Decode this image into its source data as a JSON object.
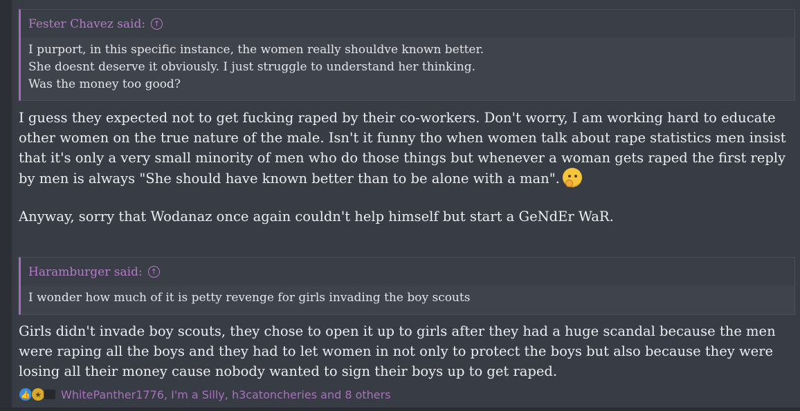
{
  "quote1": {
    "author": "Fester Chavez said:",
    "lines": [
      "I purport, in this specific instance, the women really shouldve known better.",
      "She doesnt deserve it obviously. I just struggle to understand her thinking.",
      "Was the money too good?"
    ]
  },
  "message1": {
    "paragraph1": "I guess they expected not to get fucking raped by their co-workers. Don't worry, I am working hard to educate other women on the true nature of the male. Isn't it funny tho when women talk about rape statistics men insist that it's only a very small minority of men who do those things but whenever a woman gets raped the first reply by men is always \"She should have known better than to be alone with a man\".",
    "emoji": "thinking-face-icon",
    "paragraph2": "Anyway, sorry that Wodanaz once again couldn't help himself but start a GeNdEr WaR."
  },
  "quote2": {
    "author": "Haramburger said:",
    "lines": [
      "I wonder how much of it is petty revenge for girls invading the boy scouts"
    ]
  },
  "message2": {
    "paragraph1": "Girls didn't invade boy scouts, they chose to open it up to girls after they had a huge scandal because the men were raping all the boys and they had to let women in not only to protect the boys but also because they were losing all their money cause nobody wanted to sign their boys up to get raped."
  },
  "reactions": {
    "icons": [
      "like-icon",
      "award-icon",
      "top-hat-icon"
    ],
    "names": "WhitePanther1776, I'm a Silly, h3catoncheries and 8 others"
  },
  "colors": {
    "background": "#383c45",
    "quote_accent": "#a96bbd",
    "link": "#a872bb"
  }
}
